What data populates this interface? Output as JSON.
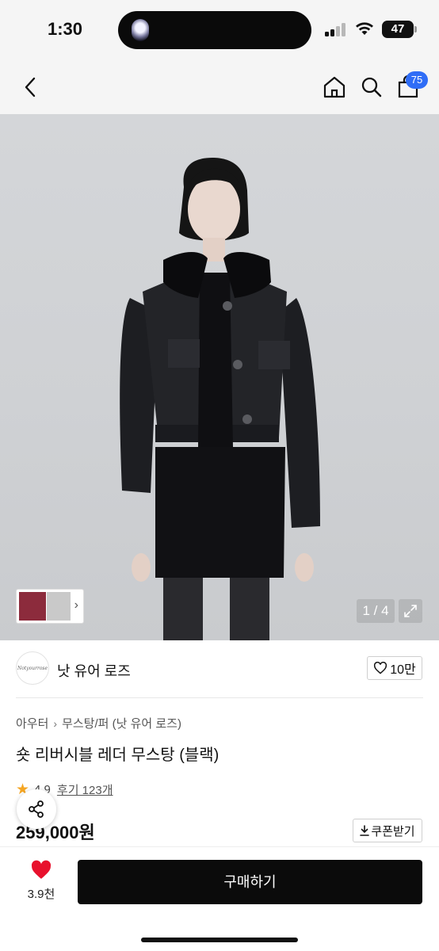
{
  "status_bar": {
    "time": "1:30",
    "battery": "47"
  },
  "nav": {
    "cart_count": "75"
  },
  "gallery": {
    "counter": "1 / 4"
  },
  "brand": {
    "name": "낫 유어 로즈",
    "logo_text": "Notyourrose",
    "likes": "10만"
  },
  "product": {
    "breadcrumb": [
      "아우터",
      "무스탕/퍼 (낫 유어 로즈)"
    ],
    "breadcrumb_sep": "›",
    "title": "숏 리버시블 레더 무스탕 (블랙)",
    "rating": "4.9",
    "reviews": "후기 123개",
    "price": "259,000원",
    "coupon": "쿠폰받기"
  },
  "bottom": {
    "wish_count": "3.9천",
    "buy_label": "구매하기"
  },
  "colors": {
    "accent_blue": "#2f6df6",
    "heart_red": "#e8112d",
    "star": "#f5a623",
    "buy_bg": "#0b0b0b"
  },
  "icons": [
    "back-icon",
    "home-icon",
    "search-icon",
    "cart-icon",
    "expand-icon",
    "heart-icon",
    "share-icon",
    "download-icon",
    "star-icon"
  ]
}
